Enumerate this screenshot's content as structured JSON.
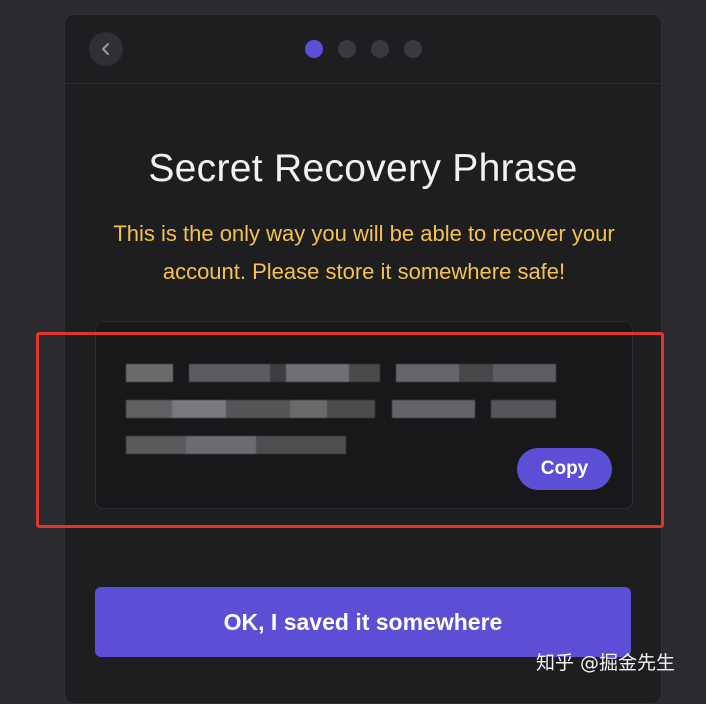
{
  "dialog": {
    "title": "Secret Recovery Phrase",
    "warning": "This is the only way you will be able to recover your account. Please store it somewhere safe!",
    "back_icon": "chevron-left-icon",
    "steps": {
      "total": 4,
      "current": 1
    }
  },
  "phrase": {
    "obscured": true,
    "copy_label": "Copy"
  },
  "actions": {
    "confirm_label": "OK, I saved it somewhere"
  },
  "watermark": {
    "text": "知乎 @掘金先生"
  },
  "colors": {
    "accent": "#5b4fd6",
    "warning": "#f2c34e",
    "highlight": "#e0352b",
    "panel": "#1e1e21"
  }
}
